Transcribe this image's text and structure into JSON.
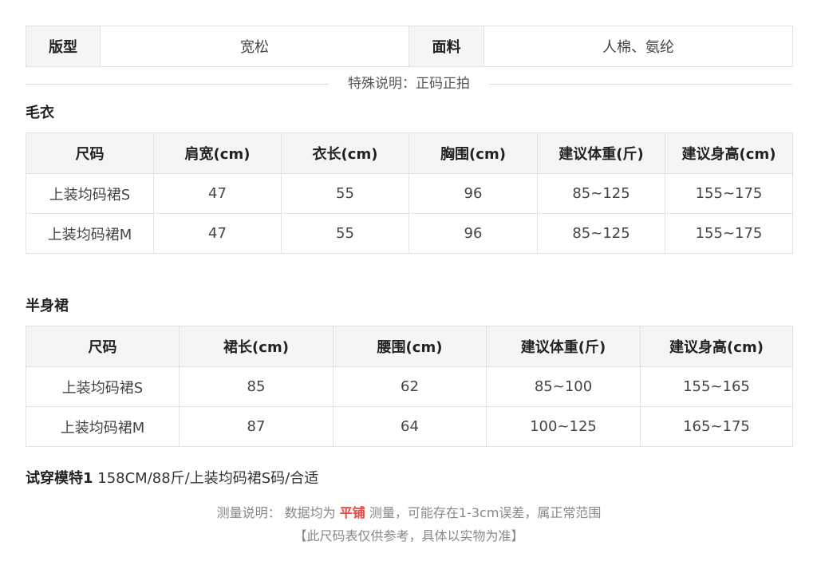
{
  "spec": {
    "fit_label": "版型",
    "fit_value": "宽松",
    "fabric_label": "面料",
    "fabric_value": "人棉、氨纶"
  },
  "special_note": "特殊说明：正码正拍",
  "sweater": {
    "title": "毛衣",
    "headers": [
      "尺码",
      "肩宽(cm)",
      "衣长(cm)",
      "胸围(cm)",
      "建议体重(斤)",
      "建议身高(cm)"
    ],
    "rows": [
      [
        "上装均码裙S",
        "47",
        "55",
        "96",
        "85~125",
        "155~175"
      ],
      [
        "上装均码裙M",
        "47",
        "55",
        "96",
        "85~125",
        "155~175"
      ]
    ]
  },
  "skirt": {
    "title": "半身裙",
    "headers": [
      "尺码",
      "裙长(cm)",
      "腰围(cm)",
      "建议体重(斤)",
      "建议身高(cm)"
    ],
    "rows": [
      [
        "上装均码裙S",
        "85",
        "62",
        "85~100",
        "155~165"
      ],
      [
        "上装均码裙M",
        "87",
        "64",
        "100~125",
        "165~175"
      ]
    ]
  },
  "model": {
    "label": "试穿模特1",
    "info": " 158CM/88斤/上装均码裙S码/合适"
  },
  "measure": {
    "prefix": "测量说明：  数据均为 ",
    "highlight": "平铺",
    "suffix": " 测量，可能存在1-3cm误差，属正常范围",
    "highlight_color": "#e8453c"
  },
  "disclaimer": "【此尺码表仅供参考，具体以实物为准】"
}
